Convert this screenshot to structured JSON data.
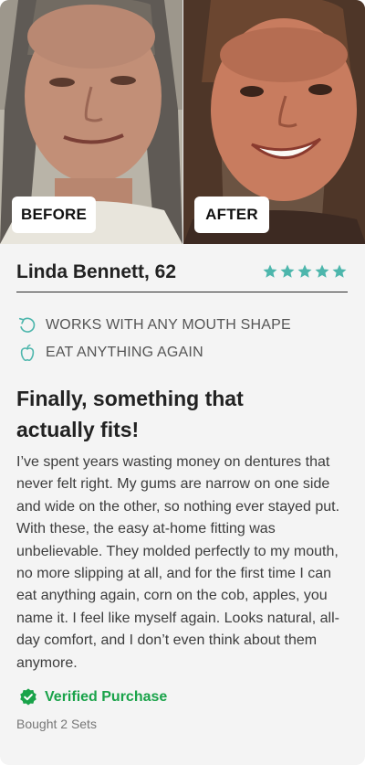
{
  "photos": {
    "before_label": "BEFORE",
    "after_label": "AFTER"
  },
  "reviewer": {
    "name": "Linda Bennett, 62",
    "rating": 5,
    "star_color": "#4db6ac"
  },
  "features": [
    {
      "icon": "rotate-icon",
      "label": "WORKS WITH ANY MOUTH SHAPE"
    },
    {
      "icon": "apple-icon",
      "label": "EAT ANYTHING AGAIN"
    }
  ],
  "review": {
    "title": "Finally, something that actually fits!",
    "body": "I’ve spent years wasting money on dentures that never felt right. My gums are narrow on one side and wide on the other, so nothing ever stayed put. With these, the easy at-home fitting was unbelievable. They molded perfectly to my mouth, no more slipping at all, and for the first time I can eat anything again, corn on the cob, apples, you name it. I feel like myself again. Looks natural, all-day comfort, and I don’t even think about them anymore."
  },
  "verification": {
    "label": "Verified Purchase",
    "icon": "verified-check-icon",
    "color": "#1aa34a"
  },
  "purchase_info": "Bought 2 Sets"
}
